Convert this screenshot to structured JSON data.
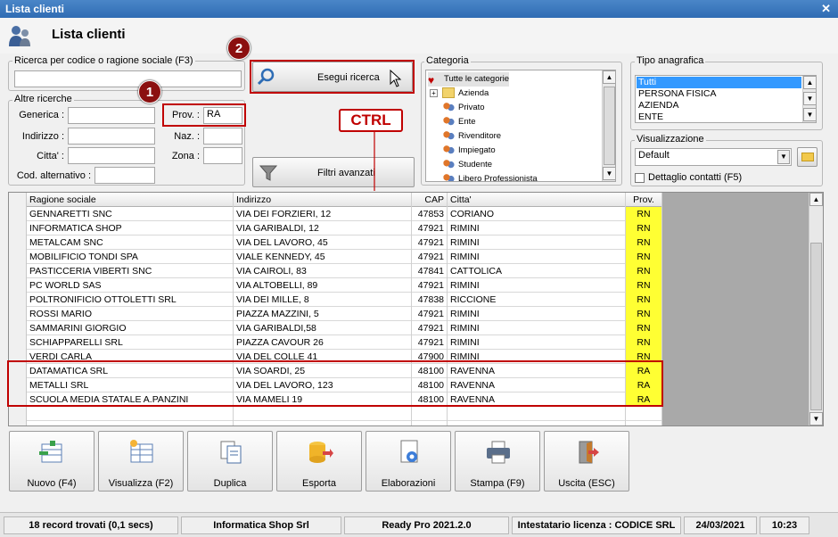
{
  "window": {
    "title": "Lista clienti"
  },
  "header": {
    "title": "Lista clienti"
  },
  "search": {
    "legend": "Ricerca per codice o ragione sociale (F3)",
    "value": "",
    "button_label": "Esegui ricerca",
    "badge": "2"
  },
  "other": {
    "legend": "Altre ricerche",
    "generica_label": "Generica :",
    "generica_value": "",
    "indirizzo_label": "Indirizzo :",
    "indirizzo_value": "",
    "citta_label": "Citta' :",
    "citta_value": "",
    "codalt_label": "Cod. alternativo :",
    "codalt_value": "",
    "prov_label": "Prov. :",
    "prov_value": "RA",
    "naz_label": "Naz. :",
    "naz_value": "",
    "zona_label": "Zona :",
    "zona_value": "",
    "badge": "1"
  },
  "filters_button": "Filtri avanzati",
  "annotation": "CTRL",
  "categoria": {
    "legend": "Categoria",
    "items": [
      "Tutte le categorie",
      "Azienda",
      "Privato",
      "Ente",
      "Rivenditore",
      "Impiegato",
      "Studente",
      "Libero Professionista"
    ]
  },
  "tipo": {
    "legend": "Tipo anagrafica",
    "items": [
      "Tutti",
      "PERSONA FISICA",
      "AZIENDA",
      "ENTE"
    ],
    "selected": "Tutti"
  },
  "visualizzazione": {
    "legend": "Visualizzazione",
    "selected": "Default",
    "checkbox_label": "Dettaglio contatti (F5)",
    "checked": false
  },
  "table": {
    "columns": [
      "Ragione sociale",
      "Indirizzo",
      "CAP",
      "Citta'",
      "Prov."
    ],
    "rows": [
      [
        "GENNARETTI SNC",
        "VIA DEI FORZIERI, 12",
        "47853",
        "CORIANO",
        "RN"
      ],
      [
        "INFORMATICA SHOP",
        "VIA GARIBALDI, 12",
        "47921",
        "RIMINI",
        "RN"
      ],
      [
        "METALCAM SNC",
        "VIA DEL LAVORO, 45",
        "47921",
        "RIMINI",
        "RN"
      ],
      [
        "MOBILIFICIO TONDI SPA",
        "VIALE KENNEDY, 45",
        "47921",
        "RIMINI",
        "RN"
      ],
      [
        "PASTICCERIA VIBERTI SNC",
        "VIA CAIROLI, 83",
        "47841",
        "CATTOLICA",
        "RN"
      ],
      [
        "PC WORLD SAS",
        "VIA ALTOBELLI, 89",
        "47921",
        "RIMINI",
        "RN"
      ],
      [
        "POLTRONIFICIO OTTOLETTI SRL",
        "VIA DEI MILLE, 8",
        "47838",
        "RICCIONE",
        "RN"
      ],
      [
        "ROSSI MARIO",
        "PIAZZA MAZZINI, 5",
        "47921",
        "RIMINI",
        "RN"
      ],
      [
        "SAMMARINI GIORGIO",
        "VIA GARIBALDI,58",
        "47921",
        "RIMINI",
        "RN"
      ],
      [
        "SCHIAPPARELLI SRL",
        "PIAZZA CAVOUR 26",
        "47921",
        "RIMINI",
        "RN"
      ],
      [
        "VERDI CARLA",
        "VIA DEL COLLE 41",
        "47900",
        "RIMINI",
        "RN"
      ],
      [
        "DATAMATICA SRL",
        "VIA SOARDI, 25",
        "48100",
        "RAVENNA",
        "RA"
      ],
      [
        "METALLI SRL",
        "VIA DEL LAVORO, 123",
        "48100",
        "RAVENNA",
        "RA"
      ],
      [
        "SCUOLA MEDIA STATALE A.PANZINI",
        "VIA MAMELI 19",
        "48100",
        "RAVENNA",
        "RA"
      ]
    ]
  },
  "toolbar": {
    "nuovo": "Nuovo (F4)",
    "visualizza": "Visualizza (F2)",
    "duplica": "Duplica",
    "esporta": "Esporta",
    "elaborazioni": "Elaborazioni",
    "stampa": "Stampa (F9)",
    "uscita": "Uscita (ESC)"
  },
  "status": {
    "records": "18 record trovati (0,1 secs)",
    "company": "Informatica Shop Srl",
    "app": "Ready Pro 2021.2.0",
    "license": "Intestatario licenza : CODICE SRL",
    "date": "24/03/2021",
    "time": "10:23"
  },
  "colors": {
    "highlight": "#c00000",
    "prov": "#ffff33",
    "selection": "#3399ff"
  }
}
